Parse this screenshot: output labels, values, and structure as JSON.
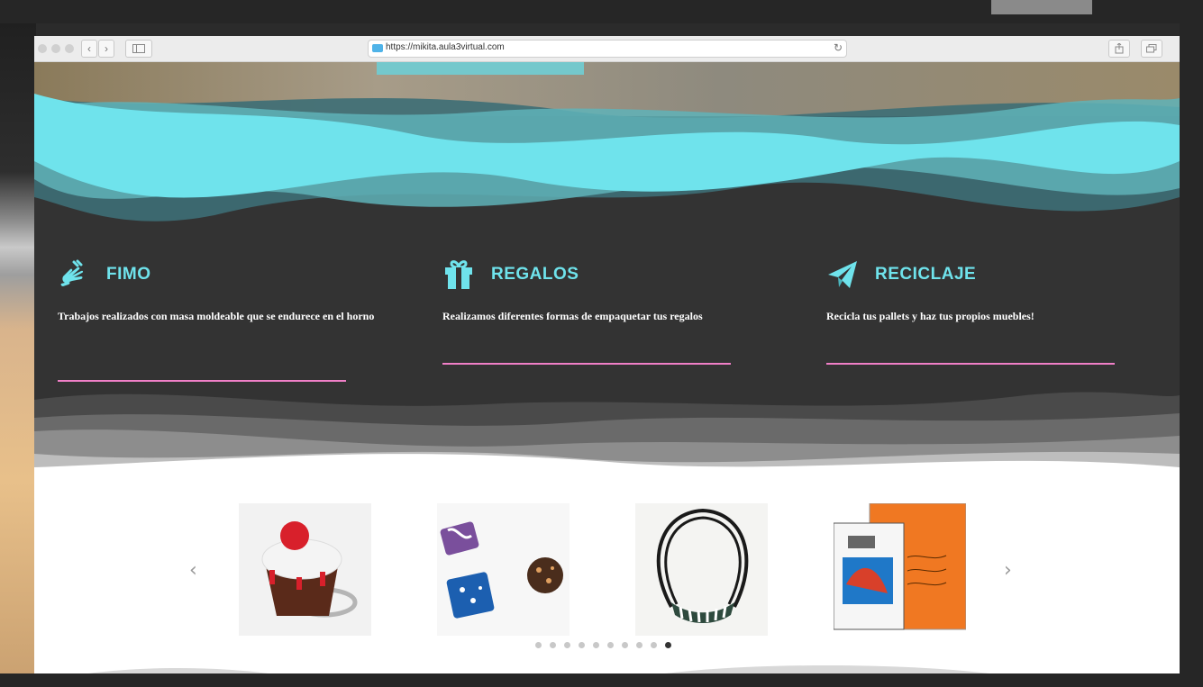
{
  "browser": {
    "url": "https://mikita.aula3virtual.com"
  },
  "features": [
    {
      "icon": "sign-language-hands-icon",
      "title": "FIMO",
      "description": "Trabajos realizados con masa moldeable que se endurece en el horno"
    },
    {
      "icon": "gift-icon",
      "title": "REGALOS",
      "description": "Realizamos diferentes formas de empaquetar tus regalos"
    },
    {
      "icon": "paper-plane-icon",
      "title": "RECICLAJE",
      "description": "Recicla tus pallets y haz tus propios muebles!"
    }
  ],
  "carousel": {
    "prev": "‹",
    "next": "›",
    "items": [
      {
        "name": "cupcake-ring-image"
      },
      {
        "name": "patterned-rings-image"
      },
      {
        "name": "striped-necklace-image"
      },
      {
        "name": "floppy-disk-notebook-image"
      }
    ],
    "dots_total": 10,
    "active_dot": 10
  },
  "colors": {
    "accent": "#6fe3ec",
    "rule": "#f07fc7",
    "dark": "#333333"
  }
}
